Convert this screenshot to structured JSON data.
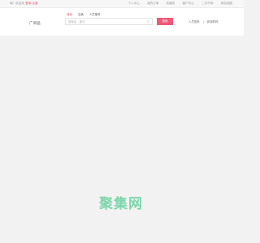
{
  "topbar": {
    "left_text": "嗨！欢迎来",
    "login": "登录",
    "register": "注册",
    "links": [
      "个人中心",
      "我的订单",
      "收藏夹",
      "客户中心",
      "二手市场",
      "网站地图"
    ]
  },
  "header": {
    "logo": "广商猛",
    "tabs": [
      "商品",
      "店铺",
      "人员推荐"
    ],
    "search_placeholder": "搜索店，宝贝",
    "search_button": "搜索",
    "hot_items": [
      "人员推荐",
      "|",
      "新旗购物"
    ]
  },
  "watermark": "聚集网"
}
